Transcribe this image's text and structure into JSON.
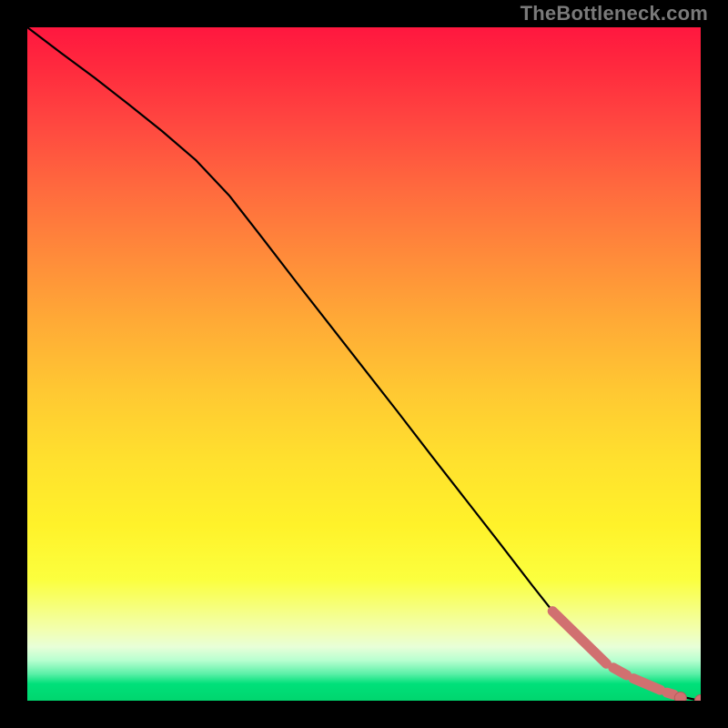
{
  "watermark": "TheBottleneck.com",
  "colors": {
    "page_bg": "#000000",
    "line": "#000000",
    "marker_fill": "#d17070",
    "marker_stroke": "#b85a5a",
    "gradient_top": "#ff173f",
    "gradient_bottom": "#00d66e"
  },
  "chart_data": {
    "type": "line",
    "title": "",
    "xlabel": "",
    "ylabel": "",
    "xlim": [
      0,
      100
    ],
    "ylim": [
      0,
      100
    ],
    "grid": false,
    "legend": false,
    "x": [
      0,
      5,
      10,
      15,
      20,
      25,
      30,
      35,
      40,
      45,
      50,
      55,
      60,
      65,
      70,
      75,
      78,
      80,
      82,
      84,
      86,
      88,
      90,
      92,
      94,
      96,
      98,
      100
    ],
    "y": [
      100,
      96.2,
      92.5,
      88.6,
      84.6,
      80.3,
      75.0,
      68.6,
      62.1,
      55.7,
      49.3,
      42.9,
      36.4,
      30.0,
      23.6,
      17.1,
      13.3,
      10.7,
      8.6,
      6.9,
      5.5,
      4.3,
      3.3,
      2.4,
      1.6,
      0.9,
      0.4,
      0.0
    ],
    "line_segments_thick": [
      {
        "x1": 78,
        "y1": 13.3,
        "x2": 86,
        "y2": 5.5
      },
      {
        "x1": 87,
        "y1": 4.9,
        "x2": 89,
        "y2": 3.8
      },
      {
        "x1": 90,
        "y1": 3.3,
        "x2": 94,
        "y2": 1.6
      },
      {
        "x1": 95,
        "y1": 1.2,
        "x2": 96,
        "y2": 0.9
      }
    ],
    "end_markers": [
      {
        "x": 97,
        "y": 0.4
      },
      {
        "x": 100,
        "y": 0.0
      }
    ]
  }
}
